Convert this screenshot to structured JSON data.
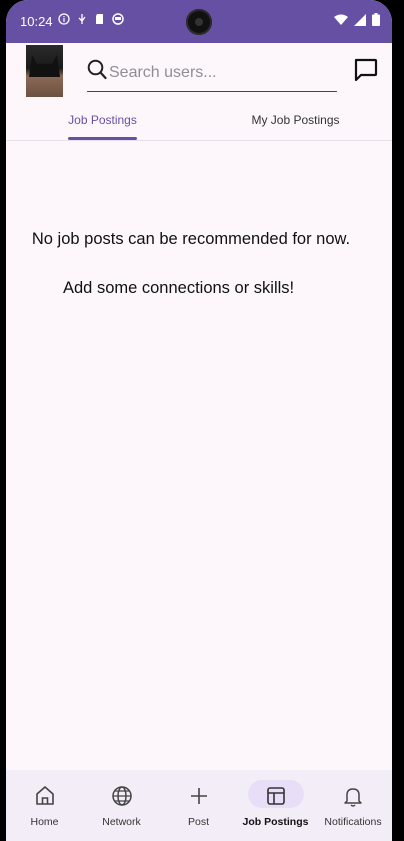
{
  "status_bar": {
    "time": "10:24"
  },
  "search": {
    "placeholder": "Search users..."
  },
  "tabs": [
    {
      "label": "Job Postings",
      "active": true
    },
    {
      "label": "My Job Postings",
      "active": false
    }
  ],
  "content": {
    "message_line1": "No job posts can be recommended for now.",
    "message_line2": "Add some connections or skills!"
  },
  "nav": [
    {
      "label": "Home",
      "icon": "home-icon"
    },
    {
      "label": "Network",
      "icon": "globe-icon"
    },
    {
      "label": "Post",
      "icon": "plus-icon"
    },
    {
      "label": "Job Postings",
      "icon": "dashboard-icon",
      "active": true
    },
    {
      "label": "Notifications",
      "icon": "bell-icon"
    }
  ],
  "colors": {
    "primary": "#6650a4",
    "background": "#fdf7fc",
    "nav_background": "#f3edf7",
    "active_pill": "#e8def8"
  }
}
